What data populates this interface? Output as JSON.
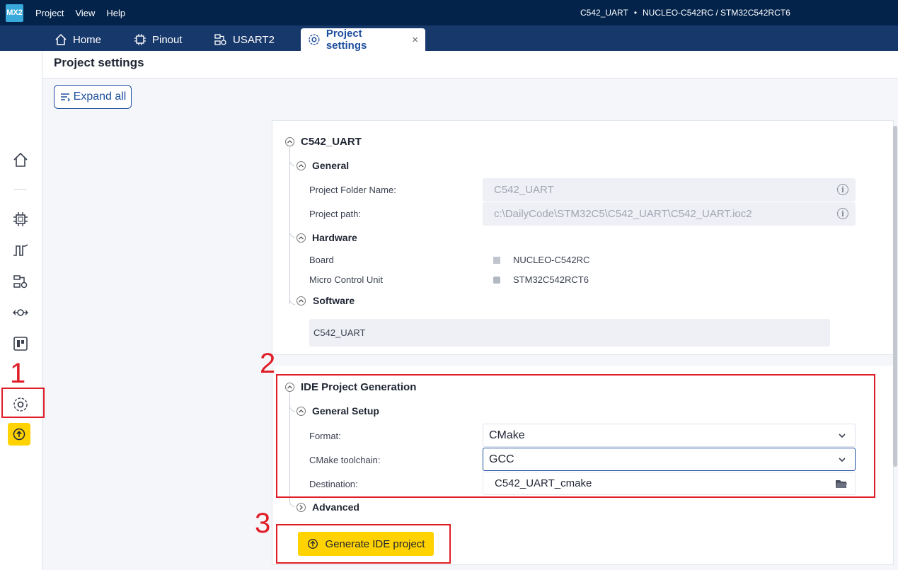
{
  "app": {
    "logo": "MX2",
    "menus": [
      "Project",
      "View",
      "Help"
    ],
    "project": "C542_UART",
    "separator": "•",
    "board_mcu": "NUCLEO-C542RC / STM32C542RCT6"
  },
  "tabs": [
    {
      "label": "Home",
      "icon": "home-icon"
    },
    {
      "label": "Pinout",
      "icon": "chip-icon"
    },
    {
      "label": "USART2",
      "icon": "peripheral-icon"
    },
    {
      "label": "Project settings",
      "icon": "settings-icon",
      "active": true,
      "close": "×"
    }
  ],
  "page": {
    "title": "Project settings",
    "expand_all": "Expand all"
  },
  "project_section": {
    "title": "C542_UART",
    "general": {
      "title": "General",
      "folder_label": "Project Folder Name:",
      "folder_value": "C542_UART",
      "path_label": "Project path:",
      "path_value": "c:\\DailyCode\\STM32C5\\C542_UART\\C542_UART.ioc2",
      "info": "i"
    },
    "hardware": {
      "title": "Hardware",
      "board_label": "Board",
      "board_value": "NUCLEO-C542RC",
      "mcu_label": "Micro Control Unit",
      "mcu_value": "STM32C542RCT6"
    },
    "software": {
      "title": "Software",
      "value": "C542_UART"
    }
  },
  "ide_section": {
    "title": "IDE Project Generation",
    "general_setup": {
      "title": "General Setup",
      "format_label": "Format:",
      "format_value": "CMake",
      "toolchain_label": "CMake toolchain:",
      "toolchain_value": "GCC",
      "destination_label": "Destination:",
      "destination_value": "C542_UART_cmake"
    },
    "advanced": "Advanced",
    "generate_button": "Generate IDE project"
  },
  "annotations": [
    "1",
    "2",
    "3"
  ],
  "colors": {
    "menubar": "#03234b",
    "tabbar": "#17386a",
    "accent": "#1e4f9f",
    "generate": "#ffd200",
    "annotation": "#e01e28"
  }
}
